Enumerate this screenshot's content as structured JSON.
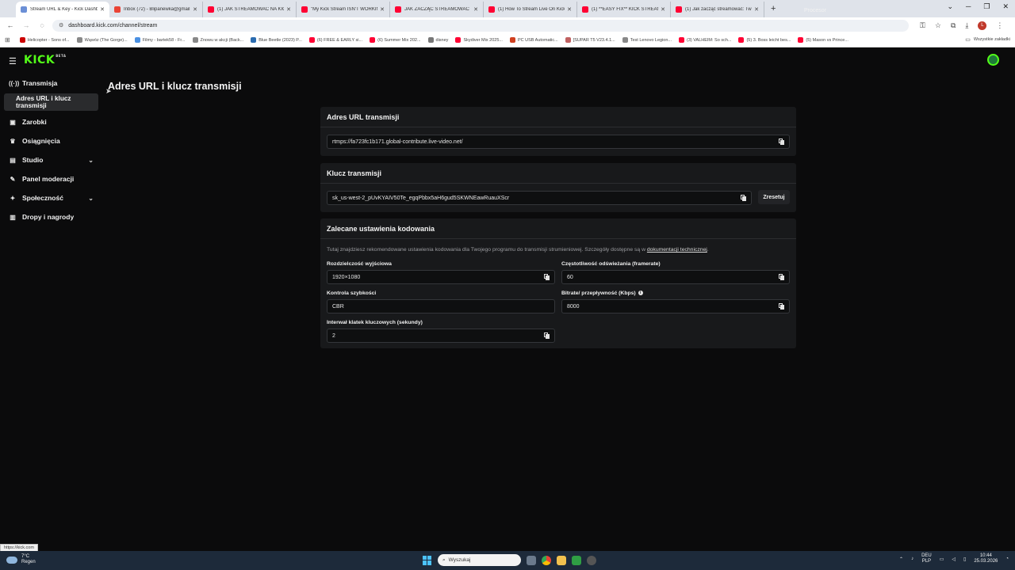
{
  "browser": {
    "tabs": [
      {
        "title": "Stream URL & Key - Kick Dashb",
        "color": "#6b8fd6",
        "active": true
      },
      {
        "title": "Inbox (72) - Blipanewka@gmail",
        "color": "#ea4335",
        "active": false
      },
      {
        "title": "(1) JAK STREAMOWAĆ NA KICK",
        "color": "#ff0033",
        "active": false
      },
      {
        "title": "\"My Kick Stream ISN'T WORKIN",
        "color": "#ff0033",
        "active": false
      },
      {
        "title": "JAK ZACZĄĆ STREAMOWAĆ",
        "color": "#ff0033",
        "active": false
      },
      {
        "title": "(1) How To Stream Live On Kick",
        "color": "#ff0033",
        "active": false
      },
      {
        "title": "(1) **EASY FIX** KICK STREAM",
        "color": "#ff0033",
        "active": false
      },
      {
        "title": "(1) Jak zacząć streamować: Tw",
        "color": "#ff0033",
        "active": false
      }
    ],
    "new_tab": "+",
    "overlay_text": "Procesor",
    "url": "dashboard.kick.com/channel/stream",
    "bookmarks": [
      {
        "label": "Helicopter - Sons of...",
        "color": "#cc0000"
      },
      {
        "label": "Wąwóz (The Gorge)...",
        "color": "#888888"
      },
      {
        "label": "Filmy - bartek58 - Fr...",
        "color": "#4a90e2"
      },
      {
        "label": "Znowu w akcji (Back...",
        "color": "#888888"
      },
      {
        "label": "Blue Beetle (2023) P...",
        "color": "#2b6cb0"
      },
      {
        "label": "(6) FREE & EARLY si...",
        "color": "#ff0033"
      },
      {
        "label": "(6) Summer Mix 202...",
        "color": "#ff0033"
      },
      {
        "label": "disney",
        "color": "#777777"
      },
      {
        "label": "Skydiver Mix 2025...",
        "color": "#ff0033"
      },
      {
        "label": "PC USB Automatic...",
        "color": "#d04020"
      },
      {
        "label": "[SUPAR T5 V23.4.1...",
        "color": "#c06060"
      },
      {
        "label": "Test Lenovo Legion...",
        "color": "#888888"
      },
      {
        "label": "(3) VALHEIM: So sch...",
        "color": "#ff0033"
      },
      {
        "label": "(5) 3. Boss leicht bes...",
        "color": "#ff0033"
      },
      {
        "label": "(5) Mason vs Prince...",
        "color": "#ff0033"
      }
    ],
    "all_bookmarks": "Wszystkie zakładki",
    "status_url": "https://kick.com"
  },
  "kick": {
    "logo": "KICK",
    "logo_badge": "BETA",
    "sidebar": {
      "items": [
        {
          "label": "Transmisja",
          "icon": "broadcast-icon",
          "glyph": "((·))"
        },
        {
          "label": "Zarobki",
          "icon": "wallet-icon",
          "glyph": "▣"
        },
        {
          "label": "Osiągnięcia",
          "icon": "trophy-icon",
          "glyph": "♛"
        },
        {
          "label": "Studio",
          "icon": "studio-icon",
          "glyph": "▤"
        },
        {
          "label": "Panel moderacji",
          "icon": "wrench-icon",
          "glyph": "✎"
        },
        {
          "label": "Społeczność",
          "icon": "community-icon",
          "glyph": "✦"
        },
        {
          "label": "Dropy i nagrody",
          "icon": "gift-icon",
          "glyph": "▥"
        }
      ],
      "subitem": "Adres URL i klucz transmisji"
    },
    "page_title": "Adres URL i klucz transmisji",
    "url_card": {
      "title": "Adres URL transmisji",
      "value": "rtmps://fa723fc1b171.global-contribute.live-video.net/"
    },
    "key_card": {
      "title": "Klucz transmisji",
      "value": "sk_us-west-2_pUvKYAIV50Te_egqPbbx5aH6gud5SKWNEawRuauXScr",
      "reset": "Zresetuj"
    },
    "encoding_card": {
      "title": "Zalecane ustawienia kodowania",
      "description": "Tutaj znajdziesz rekomendowane ustawienia kodowania dla Twojego programu do transmisji strumieniowej. Szczegóły dostępne są w",
      "link": "dokumentacji technicznej",
      "resolution_label": "Rozdzielczość wyjściowa",
      "resolution_value": "1920×1080",
      "framerate_label": "Częstotliwość odświeżania (framerate)",
      "framerate_value": "60",
      "rate_control_label": "Kontrola szybkości",
      "rate_control_value": "CBR",
      "bitrate_label": "Bitrate/ przepływność (Kbps)",
      "bitrate_value": "8000",
      "keyframe_label": "Interwał klatek kluczowych (sekundy)",
      "keyframe_value": "2"
    }
  },
  "taskbar": {
    "temp": "7°C",
    "weather": "Regen",
    "search": "Wyszukaj",
    "lang_top": "DEU",
    "lang_bottom": "PLP",
    "time": "10:44",
    "date": "25.03.2026"
  }
}
